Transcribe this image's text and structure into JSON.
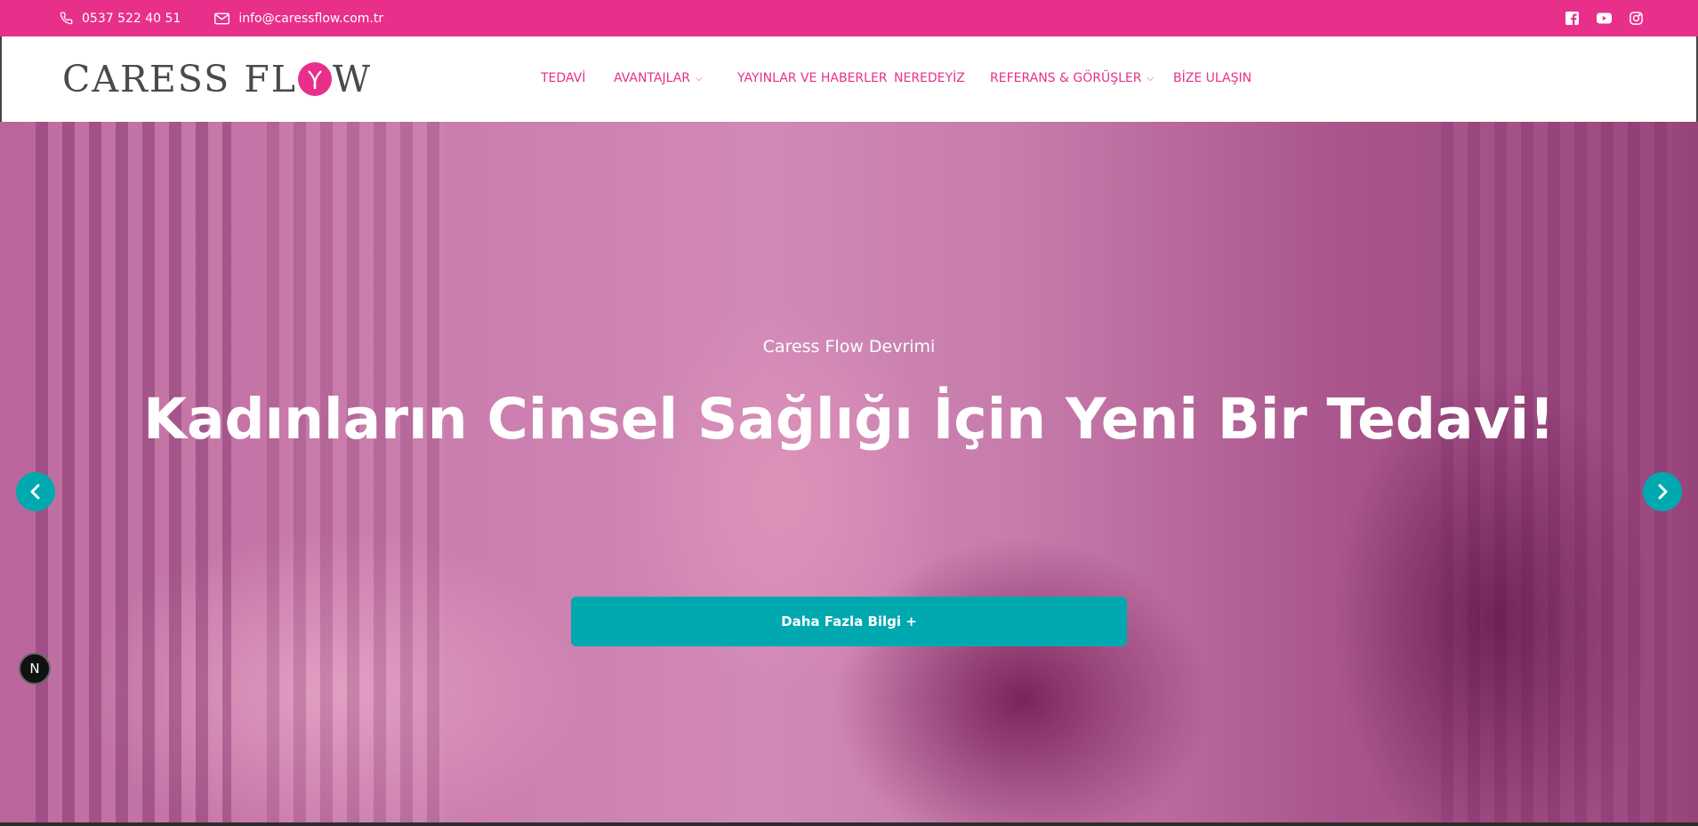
{
  "topbar": {
    "phone": "0537 522 40 51",
    "email": "info@caressflow.com.tr",
    "icons": [
      "phone-icon",
      "mail-icon",
      "facebook-icon",
      "youtube-icon",
      "instagram-icon"
    ]
  },
  "header": {
    "logo_left": "CARESS FL",
    "logo_right": "W",
    "nav": [
      {
        "label": "TEDAVİ"
      },
      {
        "label": "AVANTAJLAR",
        "dropdown": true
      },
      {
        "label": "YAYINLAR VE HABERLER"
      },
      {
        "label": "NEREDEYİZ"
      },
      {
        "label": "REFERANS & GÖRÜŞLER",
        "dropdown": true
      },
      {
        "label": "BİZE ULAŞIN"
      }
    ]
  },
  "hero": {
    "subtitle": "Caress Flow Devrimi",
    "title": "Kadınların Cinsel Sağlığı İçin Yeni Bir Tedavi!",
    "cta": "Daha Fazla Bilgi +",
    "badge": "N"
  },
  "colors": {
    "brand_pink": "#e8308a",
    "accent_teal": "#00a8b0"
  }
}
